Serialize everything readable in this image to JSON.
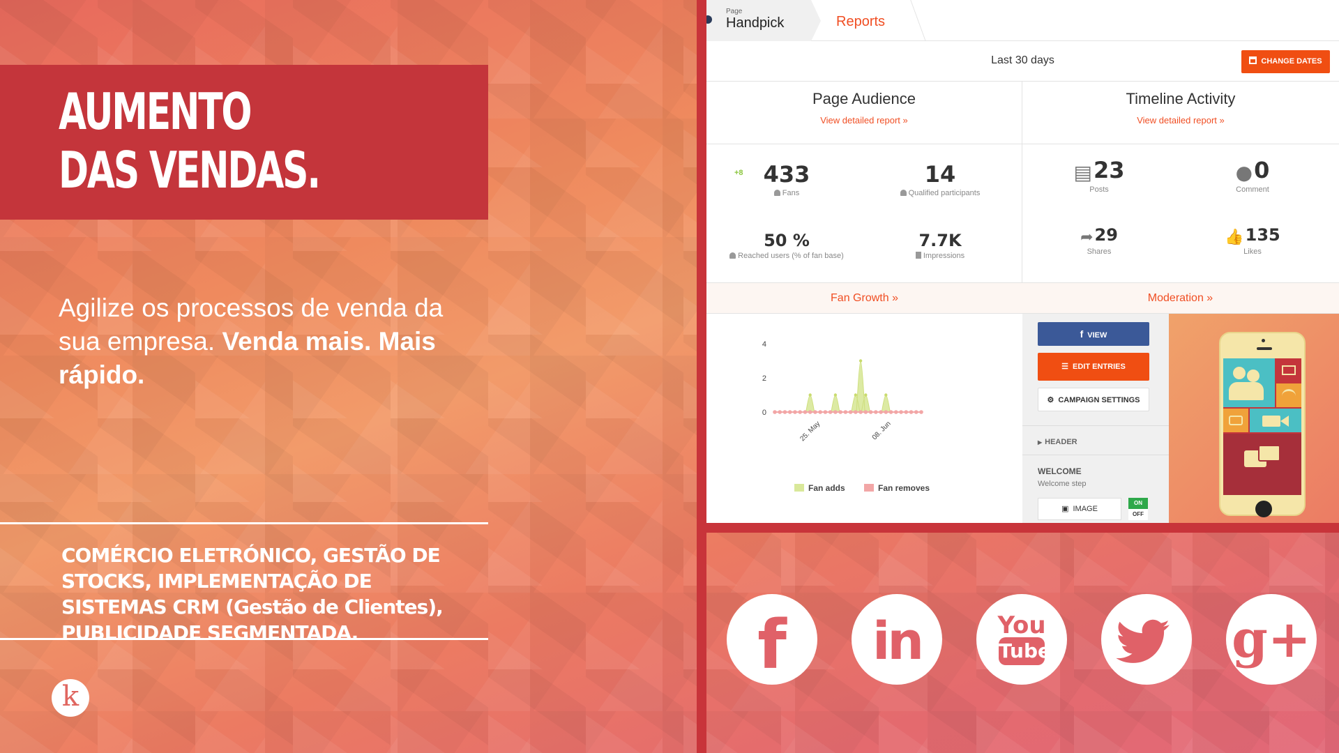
{
  "left": {
    "headline_line1": "AUMENTO",
    "headline_line2": "DAS VENDAS.",
    "subtitle_regular": "Agilize os processos de venda da sua empresa.",
    "subtitle_bold": "Venda mais. Mais rápido.",
    "services": "COMÉRCIO ELETRÓNICO, GESTÃO DE STOCKS, IMPLEMENTAÇÃO DE SISTEMAS CRM (Gestão de Clientes), PUBLICIDADE SEGMENTADA.",
    "brand_letter": "k"
  },
  "colors": {
    "accent_red": "#c4353b",
    "orange": "#f04e12",
    "facebook_blue": "#3b5998",
    "icon_pink": "#e06168"
  },
  "dashboard": {
    "breadcrumb_small": "Page",
    "breadcrumb_page": "Handpick",
    "breadcrumb_reports": "Reports",
    "date_range": "Last 30 days",
    "change_dates": "CHANGE DATES",
    "page_audience": {
      "title": "Page Audience",
      "link": "View detailed report »",
      "fans_delta": "+8",
      "fans": "433",
      "fans_label": "Fans",
      "qualified": "14",
      "qualified_label": "Qualified participants",
      "reached": "50 %",
      "reached_label": "Reached users (% of fan base)",
      "impressions": "7.7K",
      "impressions_label": "Impressions"
    },
    "timeline_activity": {
      "title": "Timeline Activity",
      "link": "View detailed report »",
      "posts": "23",
      "posts_label": "Posts",
      "comment": "0",
      "comment_label": "Comment",
      "shares": "29",
      "shares_label": "Shares",
      "likes": "135",
      "likes_label": "Likes"
    },
    "tabs": {
      "fan_growth": "Fan Growth »",
      "moderation": "Moderation »"
    },
    "editor": {
      "view": "VIEW",
      "edit_entries": "EDIT ENTRIES",
      "campaign_settings": "CAMPAIGN SETTINGS",
      "header": "HEADER",
      "welcome": "WELCOME",
      "welcome_step": "Welcome step",
      "image": "IMAGE",
      "toggle_on": "ON",
      "toggle_off": "OFF"
    }
  },
  "chart_data": {
    "type": "area",
    "title": "",
    "xlabel": "",
    "ylabel": "",
    "x_tick_labels": [
      "25. May",
      "08. Jun"
    ],
    "y_ticks": [
      0,
      2,
      4
    ],
    "ylim": [
      0,
      4
    ],
    "x": [
      1,
      2,
      3,
      4,
      5,
      6,
      7,
      8,
      9,
      10,
      11,
      12,
      13,
      14,
      15,
      16,
      17,
      18,
      19,
      20,
      21,
      22,
      23,
      24,
      25,
      26,
      27,
      28,
      29,
      30
    ],
    "x_tick_positions": [
      10,
      24
    ],
    "series": [
      {
        "name": "Fan adds",
        "color": "#d9e89a",
        "values": [
          0,
          0,
          0,
          0,
          0,
          0,
          0,
          1,
          0,
          0,
          0,
          0,
          1,
          0,
          0,
          0,
          1,
          3,
          1,
          0,
          0,
          0,
          1,
          0,
          0,
          0,
          0,
          0,
          0,
          0
        ]
      },
      {
        "name": "Fan removes",
        "color": "#f2a6a6",
        "values": [
          0,
          0,
          0,
          0,
          0,
          0,
          0,
          0,
          0,
          0,
          0,
          0,
          0,
          0,
          0,
          0,
          0,
          0,
          0,
          0,
          0,
          0,
          0,
          0,
          0,
          0,
          0,
          0,
          0,
          0
        ]
      }
    ],
    "legend": "bottom"
  },
  "social": {
    "icons": [
      "facebook-icon",
      "linkedin-icon",
      "youtube-icon",
      "twitter-icon",
      "google-plus-icon"
    ],
    "facebook": "f",
    "linkedin": "in",
    "youtube_you": "You",
    "youtube_tube": "Tube",
    "googleplus": "g+"
  }
}
